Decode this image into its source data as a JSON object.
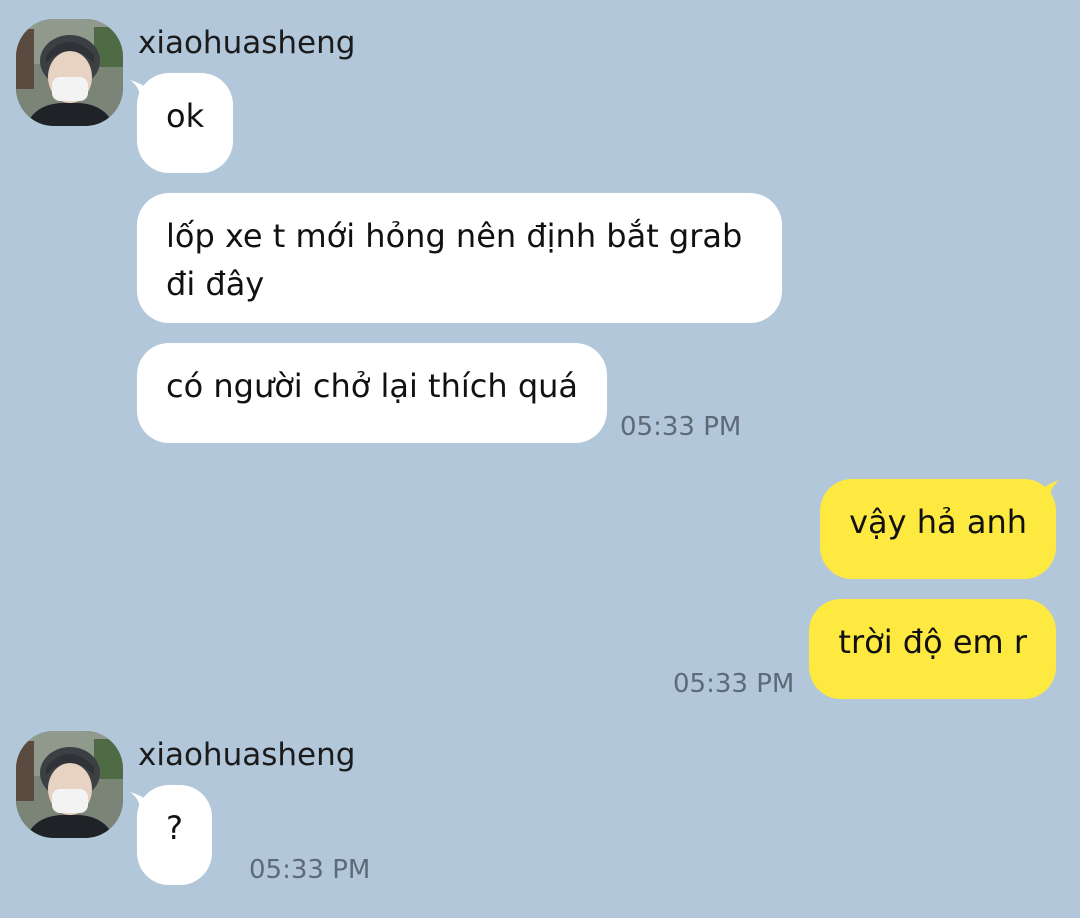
{
  "sender": {
    "name": "xiaohuasheng"
  },
  "messages": {
    "incoming_group_1": {
      "sender_name": "xiaohuasheng",
      "bubbles": [
        "ok",
        "lốp xe t mới hỏng nên định bắt grab đi đây",
        "có người chở lại thích quá"
      ],
      "time": "05:33 PM"
    },
    "outgoing_group_1": {
      "bubbles": [
        "vậy hả anh",
        "trời độ em r"
      ],
      "time": "05:33 PM"
    },
    "incoming_group_2": {
      "sender_name": "xiaohuasheng",
      "bubbles": [
        "?"
      ],
      "time": "05:33 PM"
    }
  },
  "colors": {
    "background": "#b2c7da",
    "incoming_bubble": "#ffffff",
    "outgoing_bubble": "#fde93f",
    "time_text": "#5d6b78"
  },
  "icons": {
    "avatar": "profile-photo"
  }
}
